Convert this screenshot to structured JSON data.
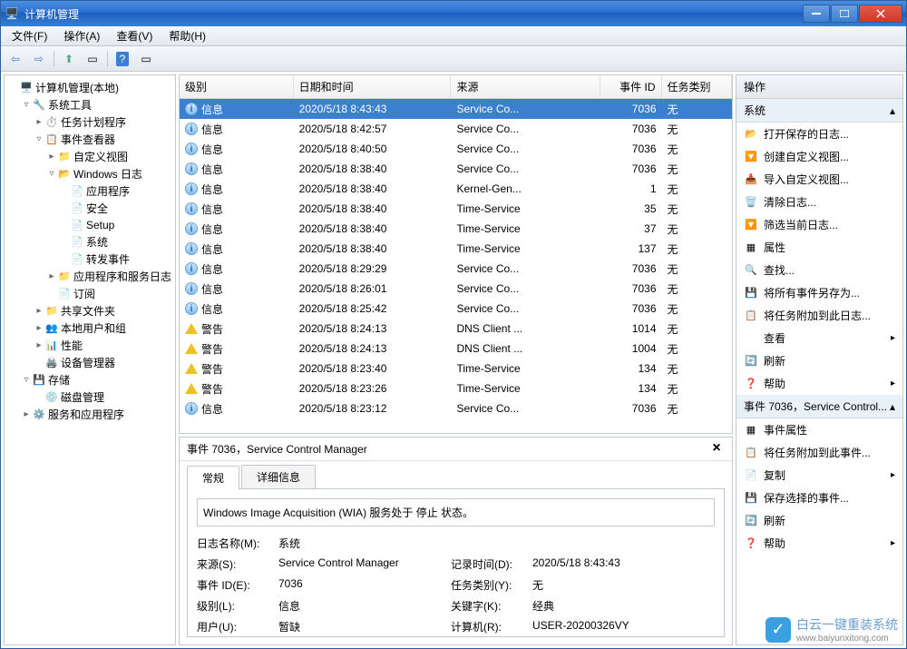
{
  "title": "计算机管理",
  "menus": [
    "文件(F)",
    "操作(A)",
    "查看(V)",
    "帮助(H)"
  ],
  "tree": [
    {
      "label": "计算机管理(本地)",
      "indent": 0,
      "toggle": ""
    },
    {
      "label": "系统工具",
      "indent": 1,
      "toggle": "▿"
    },
    {
      "label": "任务计划程序",
      "indent": 2,
      "toggle": "▸"
    },
    {
      "label": "事件查看器",
      "indent": 2,
      "toggle": "▿"
    },
    {
      "label": "自定义视图",
      "indent": 3,
      "toggle": "▸"
    },
    {
      "label": "Windows 日志",
      "indent": 3,
      "toggle": "▿"
    },
    {
      "label": "应用程序",
      "indent": 4,
      "toggle": ""
    },
    {
      "label": "安全",
      "indent": 4,
      "toggle": ""
    },
    {
      "label": "Setup",
      "indent": 4,
      "toggle": ""
    },
    {
      "label": "系统",
      "indent": 4,
      "toggle": ""
    },
    {
      "label": "转发事件",
      "indent": 4,
      "toggle": ""
    },
    {
      "label": "应用程序和服务日志",
      "indent": 3,
      "toggle": "▸"
    },
    {
      "label": "订阅",
      "indent": 3,
      "toggle": ""
    },
    {
      "label": "共享文件夹",
      "indent": 2,
      "toggle": "▸"
    },
    {
      "label": "本地用户和组",
      "indent": 2,
      "toggle": "▸"
    },
    {
      "label": "性能",
      "indent": 2,
      "toggle": "▸"
    },
    {
      "label": "设备管理器",
      "indent": 2,
      "toggle": ""
    },
    {
      "label": "存储",
      "indent": 1,
      "toggle": "▿"
    },
    {
      "label": "磁盘管理",
      "indent": 2,
      "toggle": ""
    },
    {
      "label": "服务和应用程序",
      "indent": 1,
      "toggle": "▸"
    }
  ],
  "columns": {
    "level": "级别",
    "date": "日期和时间",
    "source": "来源",
    "id": "事件 ID",
    "cat": "任务类别"
  },
  "events": [
    {
      "level": "信息",
      "type": "info",
      "date": "2020/5/18 8:43:43",
      "source": "Service Co...",
      "id": "7036",
      "cat": "无",
      "selected": true
    },
    {
      "level": "信息",
      "type": "info",
      "date": "2020/5/18 8:42:57",
      "source": "Service Co...",
      "id": "7036",
      "cat": "无"
    },
    {
      "level": "信息",
      "type": "info",
      "date": "2020/5/18 8:40:50",
      "source": "Service Co...",
      "id": "7036",
      "cat": "无"
    },
    {
      "level": "信息",
      "type": "info",
      "date": "2020/5/18 8:38:40",
      "source": "Service Co...",
      "id": "7036",
      "cat": "无"
    },
    {
      "level": "信息",
      "type": "info",
      "date": "2020/5/18 8:38:40",
      "source": "Kernel-Gen...",
      "id": "1",
      "cat": "无"
    },
    {
      "level": "信息",
      "type": "info",
      "date": "2020/5/18 8:38:40",
      "source": "Time-Service",
      "id": "35",
      "cat": "无"
    },
    {
      "level": "信息",
      "type": "info",
      "date": "2020/5/18 8:38:40",
      "source": "Time-Service",
      "id": "37",
      "cat": "无"
    },
    {
      "level": "信息",
      "type": "info",
      "date": "2020/5/18 8:38:40",
      "source": "Time-Service",
      "id": "137",
      "cat": "无"
    },
    {
      "level": "信息",
      "type": "info",
      "date": "2020/5/18 8:29:29",
      "source": "Service Co...",
      "id": "7036",
      "cat": "无"
    },
    {
      "level": "信息",
      "type": "info",
      "date": "2020/5/18 8:26:01",
      "source": "Service Co...",
      "id": "7036",
      "cat": "无"
    },
    {
      "level": "信息",
      "type": "info",
      "date": "2020/5/18 8:25:42",
      "source": "Service Co...",
      "id": "7036",
      "cat": "无"
    },
    {
      "level": "警告",
      "type": "warn",
      "date": "2020/5/18 8:24:13",
      "source": "DNS Client ...",
      "id": "1014",
      "cat": "无"
    },
    {
      "level": "警告",
      "type": "warn",
      "date": "2020/5/18 8:24:13",
      "source": "DNS Client ...",
      "id": "1004",
      "cat": "无"
    },
    {
      "level": "警告",
      "type": "warn",
      "date": "2020/5/18 8:23:40",
      "source": "Time-Service",
      "id": "134",
      "cat": "无"
    },
    {
      "level": "警告",
      "type": "warn",
      "date": "2020/5/18 8:23:26",
      "source": "Time-Service",
      "id": "134",
      "cat": "无"
    },
    {
      "level": "信息",
      "type": "info",
      "date": "2020/5/18 8:23:12",
      "source": "Service Co...",
      "id": "7036",
      "cat": "无"
    }
  ],
  "detail": {
    "title": "事件 7036，Service Control Manager",
    "tabs": [
      "常规",
      "详细信息"
    ],
    "desc": "Windows Image Acquisition (WIA) 服务处于 停止 状态。",
    "props": {
      "logname_l": "日志名称(M):",
      "logname_v": "系统",
      "source_l": "来源(S):",
      "source_v": "Service Control Manager",
      "logtime_l": "记录时间(D):",
      "logtime_v": "2020/5/18 8:43:43",
      "eventid_l": "事件 ID(E):",
      "eventid_v": "7036",
      "taskcat_l": "任务类别(Y):",
      "taskcat_v": "无",
      "level_l": "级别(L):",
      "level_v": "信息",
      "keyword_l": "关键字(K):",
      "keyword_v": "经典",
      "user_l": "用户(U):",
      "user_v": "暂缺",
      "computer_l": "计算机(R):",
      "computer_v": "USER-20200326VY"
    }
  },
  "actions": {
    "header": "操作",
    "section1": "系统",
    "section1_items": [
      {
        "label": "打开保存的日志...",
        "arrow": false
      },
      {
        "label": "创建自定义视图...",
        "arrow": false
      },
      {
        "label": "导入自定义视图...",
        "arrow": false
      },
      {
        "label": "清除日志...",
        "arrow": false
      },
      {
        "label": "筛选当前日志...",
        "arrow": false
      },
      {
        "label": "属性",
        "arrow": false
      },
      {
        "label": "查找...",
        "arrow": false
      },
      {
        "label": "将所有事件另存为...",
        "arrow": false
      },
      {
        "label": "将任务附加到此日志...",
        "arrow": false
      },
      {
        "label": "查看",
        "arrow": true
      },
      {
        "label": "刷新",
        "arrow": false
      },
      {
        "label": "帮助",
        "arrow": true
      }
    ],
    "section2": "事件 7036，Service Control...",
    "section2_items": [
      {
        "label": "事件属性",
        "arrow": false
      },
      {
        "label": "将任务附加到此事件...",
        "arrow": false
      },
      {
        "label": "复制",
        "arrow": true
      },
      {
        "label": "保存选择的事件...",
        "arrow": false
      },
      {
        "label": "刷新",
        "arrow": false
      },
      {
        "label": "帮助",
        "arrow": true
      }
    ]
  },
  "watermark": {
    "brand": "白云一键重装系统",
    "url": "www.baiyunxitong.com"
  }
}
